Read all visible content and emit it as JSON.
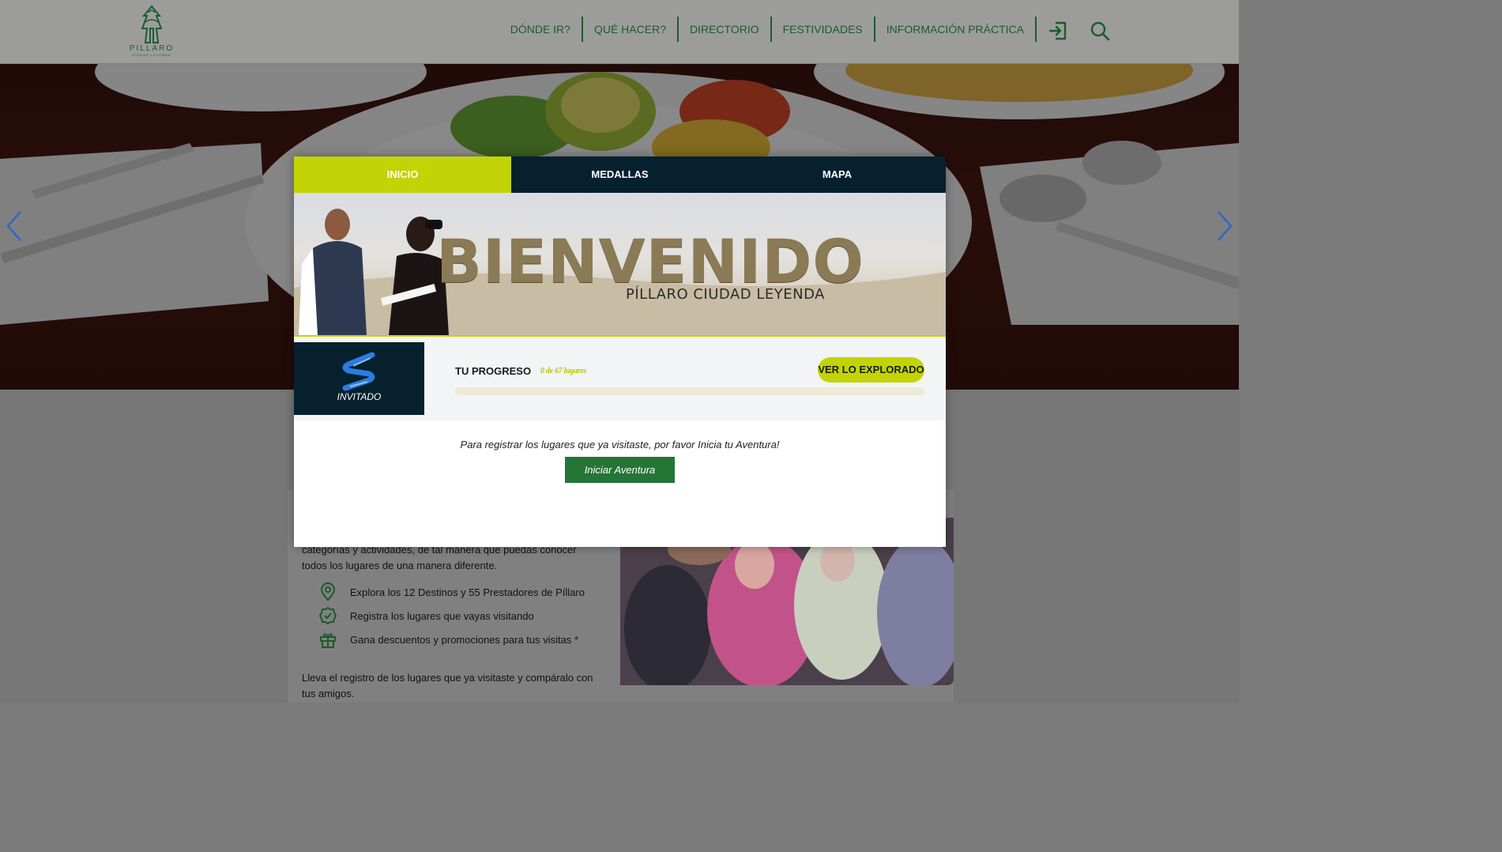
{
  "header": {
    "logo_text": "PILLARO",
    "logo_subtext": "CIUDAD LEYENDA",
    "nav": [
      "DÓNDE IR?",
      "QUÉ HACER?",
      "DIRECTORIO",
      "FESTIVIDADES",
      "INFORMACIÓN PRÁCTICA"
    ],
    "icons": [
      "login-icon",
      "search-icon"
    ]
  },
  "colors": {
    "accent": "#c2d405",
    "dark": "#06202e",
    "brand_green": "#247536",
    "nav_text": "#1d5a2b"
  },
  "modal": {
    "tabs": [
      "INICIO",
      "MEDALLAS",
      "MAPA"
    ],
    "active_tab": "INICIO",
    "banner": {
      "title": "BIENVENIDO",
      "subtitle": "PÍLLARO CIUDAD LEYENDA"
    },
    "user": {
      "label": "INVITADO"
    },
    "progress": {
      "title": "TU PROGRESO",
      "count_text": "0 de 67 lugares",
      "fraction": 0,
      "button": "VER LO EXPLORADO"
    },
    "message": "Para registrar los lugares que ya visitaste, por favor Inicia tu Aventura!",
    "start_button": "Iniciar Aventura"
  },
  "page": {
    "intro_text": "categorías y actividades, de tal manera que puedas conocer todos los lugares de una manera diferente.",
    "features": [
      "Explora los 12 Destinos y 55 Prestadores de Píllaro",
      "Registra los lugares que vayas visitando",
      "Gana descuentos y promociones para tus visitas *"
    ],
    "outro_text": "Lleva el registro de los lugares que ya visitaste y compáralo con tus amigos."
  }
}
